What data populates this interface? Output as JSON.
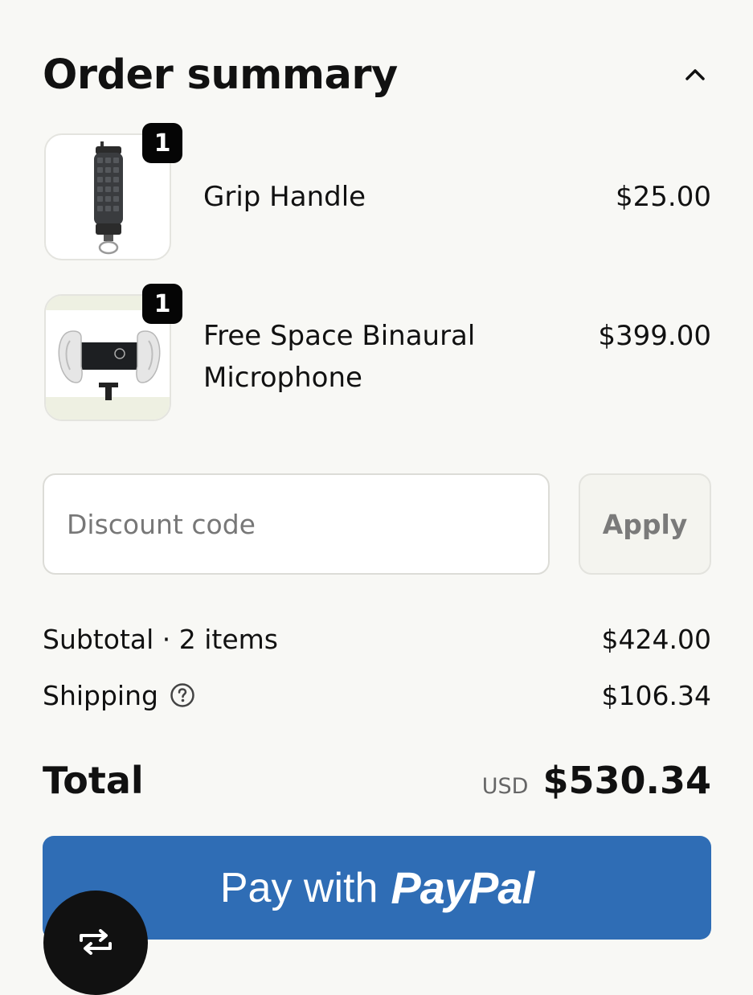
{
  "header": {
    "title": "Order summary",
    "collapse_icon": "chevron-up-icon"
  },
  "items": [
    {
      "name": "Grip Handle",
      "price": "$25.00",
      "quantity": "1"
    },
    {
      "name": "Free Space Binaural Microphone",
      "price": "$399.00",
      "quantity": "1"
    }
  ],
  "discount": {
    "placeholder": "Discount code",
    "apply_label": "Apply"
  },
  "summary": {
    "subtotal_label": "Subtotal · 2 items",
    "subtotal_value": "$424.00",
    "shipping_label": "Shipping",
    "shipping_value": "$106.34",
    "shipping_help_icon": "question-circle-icon",
    "total_label": "Total",
    "currency": "USD",
    "total_value": "$530.34"
  },
  "paypal": {
    "prefix": "Pay with",
    "brand": "PayPal",
    "color": "#2f6db5"
  },
  "fab": {
    "icon": "swap-arrows-icon"
  }
}
